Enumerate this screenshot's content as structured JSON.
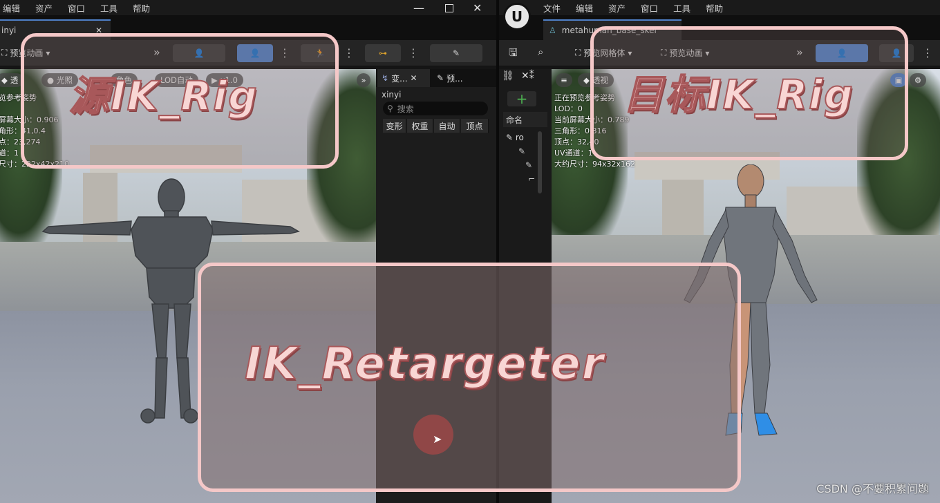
{
  "left_window": {
    "menu": [
      "编辑",
      "资产",
      "窗口",
      "工具",
      "帮助"
    ],
    "tab_label": "inyi",
    "toolbar": {
      "preview_anim_label": "预览动画"
    },
    "viewport": {
      "perspective_label": "透",
      "lit_label": "光照",
      "character_label": "角色",
      "lod_label": "LOD自动",
      "speed_label": "x1.0",
      "stats": [
        "览参考姿势",
        "屏幕大小：0.906",
        "角形：41,0.4",
        "点：23,274",
        "道：1",
        "尺寸：222x42x210"
      ]
    }
  },
  "middle_panel": {
    "tab_transform": "变...",
    "tab_preview": "预...",
    "asset_name": "xinyi",
    "search_placeholder": "搜索",
    "columns": [
      "变形",
      "权重",
      "自动",
      "顶点"
    ]
  },
  "hierarchy_panel": {
    "header": "命名",
    "root_label": "ro"
  },
  "right_window": {
    "menu": [
      "文件",
      "编辑",
      "资产",
      "窗口",
      "工具",
      "帮助"
    ],
    "tab_label": "metahuman_base_skel",
    "toolbar": {
      "preview_mesh_label": "预览网格体",
      "preview_anim_label": "预览动画"
    },
    "viewport": {
      "perspective_label": "透视",
      "stats": [
        "正在预览参考姿势",
        "LOD：0",
        "当前屏幕大小：0.789",
        "三角形：0,816",
        "顶点：32,40",
        "UV通道：1",
        "大约尺寸：94x32x162"
      ]
    }
  },
  "annotations": {
    "source": "源IK_Rig",
    "target": "目标IK_Rig",
    "retargeter": "IK_Retargeter",
    "color": "#f5c8c8"
  },
  "watermark": "CSDN @不要积累问题"
}
